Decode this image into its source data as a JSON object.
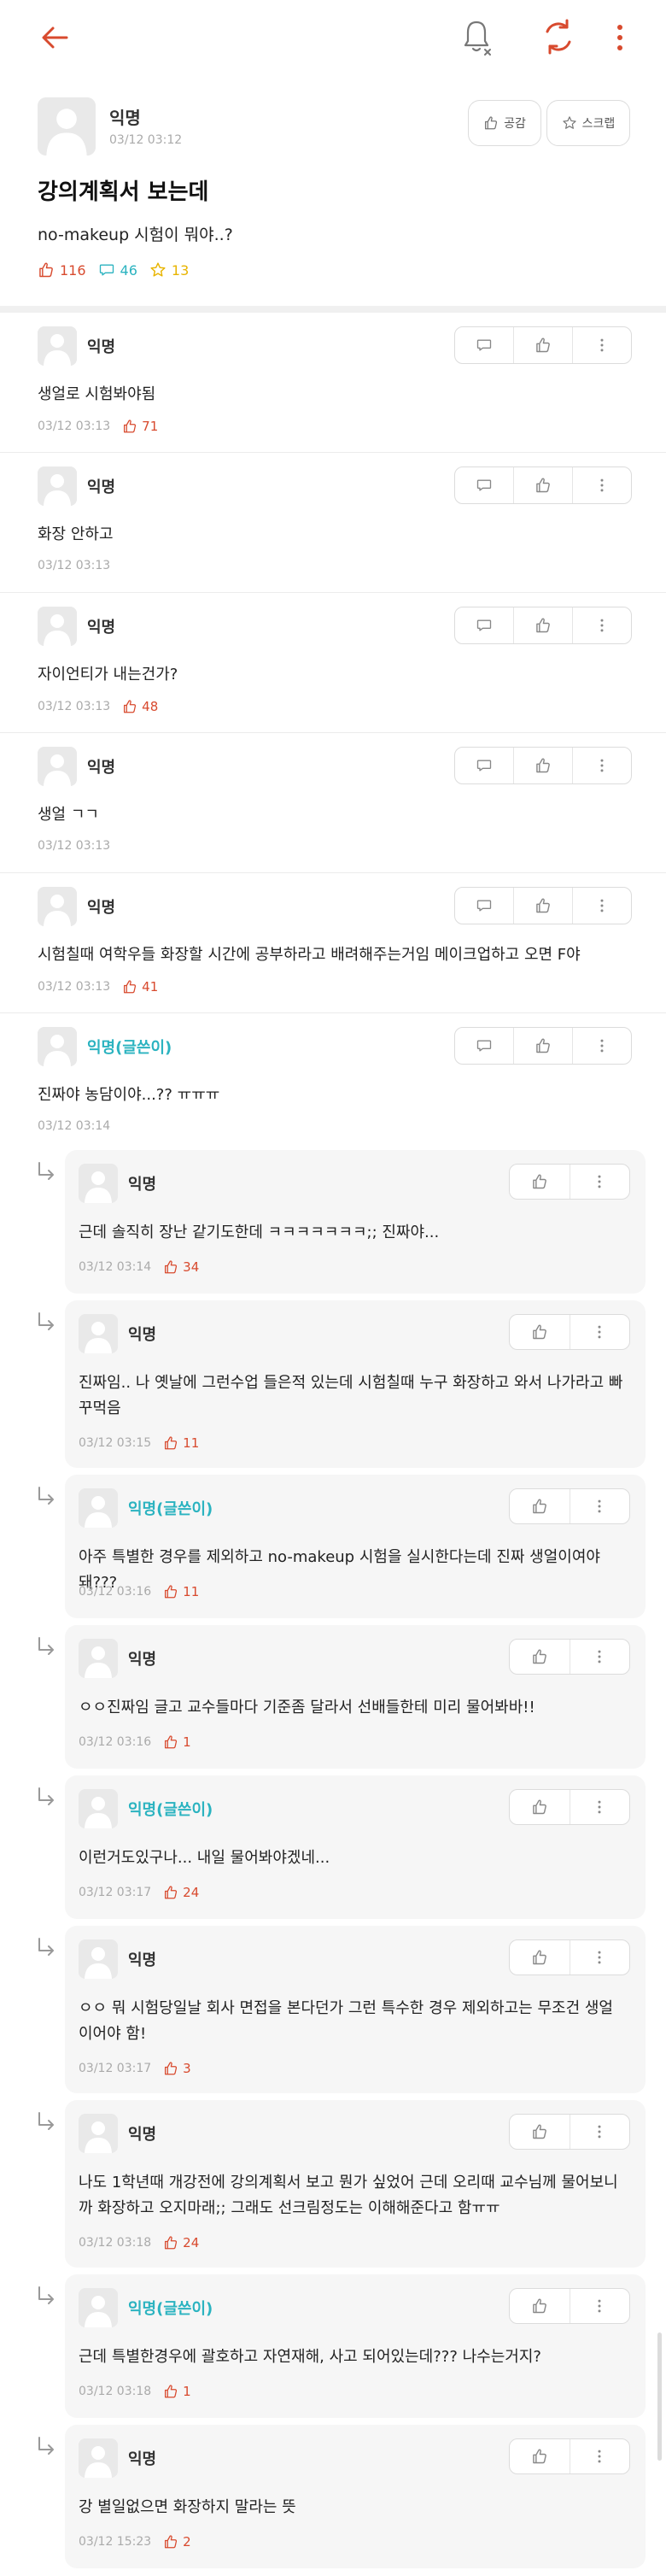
{
  "colors": {
    "accent": "#d84a2e",
    "op": "#2bb3c0",
    "scrap": "#e8b400"
  },
  "post": {
    "author": "익명",
    "time": "03/12 03:12",
    "like_label": "공감",
    "scrap_label": "스크랩",
    "title": "강의계획서 보는데",
    "body": "no-makeup 시험이 뭐야..?",
    "likes": "116",
    "comments": "46",
    "scraps": "13"
  },
  "comments": [
    {
      "author": "익명",
      "text": "생얼로 시험봐야됨",
      "time": "03/12 03:13",
      "likes": "71"
    },
    {
      "author": "익명",
      "text": "화장 안하고",
      "time": "03/12 03:13",
      "likes": ""
    },
    {
      "author": "익명",
      "text": "자이언티가 내는건가?",
      "time": "03/12 03:13",
      "likes": "48"
    },
    {
      "author": "익명",
      "text": "생얼 ㄱㄱ",
      "time": "03/12 03:13",
      "likes": ""
    },
    {
      "author": "익명",
      "text": "시험칠때 여학우들 화장할 시간에 공부하라고 배려해주는거임 메이크업하고 오면 F야",
      "time": "03/12 03:13",
      "likes": "41"
    },
    {
      "author": "익명(글쓴이)",
      "text": "진짜야 농담이야...?? ㅠㅠㅠ",
      "time": "03/12 03:14",
      "likes": ""
    }
  ],
  "replies": [
    {
      "author": "익명",
      "text": "근데 솔직히 장난 같기도한데 ㅋㅋㅋㅋㅋㅋㅋ;; 진짜야...",
      "time": "03/12 03:14",
      "likes": "34"
    },
    {
      "author": "익명",
      "text": "진짜임.. 나 옛날에 그런수업 들은적 있는데 시험칠때 누구 화장하고 와서 나가라고 빠꾸먹음",
      "time": "03/12 03:15",
      "likes": "11"
    },
    {
      "author": "익명(글쓴이)",
      "text": "아주 특별한 경우를 제외하고 no-makeup 시험을 실시한다는데 진짜 생얼이여야돼???",
      "time": "03/12 03:16",
      "likes": "11"
    },
    {
      "author": "익명",
      "text": "ㅇㅇ진짜임 글고 교수들마다 기준좀 달라서 선배들한테 미리 물어봐바!!",
      "time": "03/12 03:16",
      "likes": "1"
    },
    {
      "author": "익명(글쓴이)",
      "text": "이런거도있구나... 내일 물어봐야겠네...",
      "time": "03/12 03:17",
      "likes": "24"
    },
    {
      "author": "익명",
      "text": "ㅇㅇ 뭐 시험당일날 회사 면접을 본다던가 그런 특수한 경우 제외하고는 무조건 생얼이어야 함!",
      "time": "03/12 03:17",
      "likes": "3"
    },
    {
      "author": "익명",
      "text": "나도 1학년때 개강전에 강의계획서 보고 뭔가 싶었어 근데 오리때 교수님께 물어보니까 화장하고 오지마래;; 그래도 선크림정도는 이해해준다고 함ㅠㅠ",
      "time": "03/12 03:18",
      "likes": "24"
    },
    {
      "author": "익명(글쓴이)",
      "text": "근데 특별한경우에 괄호하고 자연재해, 사고 되어있는데??? 나수는거지?",
      "time": "03/12 03:18",
      "likes": "1"
    },
    {
      "author": "익명",
      "text": "강 별일없으면 화장하지 말라는 뜻",
      "time": "03/12 15:23",
      "likes": "2"
    }
  ]
}
